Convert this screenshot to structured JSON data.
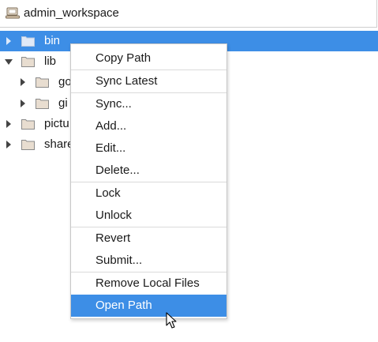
{
  "workspace": {
    "title": "admin_workspace",
    "icon": "workspace-icon"
  },
  "tree": {
    "items": [
      {
        "label": "bin",
        "icon": "folder-icon",
        "expander": "collapsed",
        "selected": true
      },
      {
        "label": "lib",
        "icon": "folder-icon",
        "expander": "expanded",
        "selected": false
      },
      {
        "label": "go",
        "icon": "folder-icon",
        "expander": "collapsed",
        "selected": false
      },
      {
        "label": "gi",
        "icon": "folder-icon",
        "expander": "collapsed",
        "selected": false
      },
      {
        "label": "pictu",
        "icon": "folder-icon",
        "expander": "collapsed",
        "selected": false
      },
      {
        "label": "share",
        "icon": "folder-icon",
        "expander": "collapsed",
        "selected": false
      }
    ]
  },
  "context_menu": {
    "items": [
      {
        "label": "Copy Path"
      },
      {
        "label": "Sync Latest"
      },
      {
        "label": "Sync..."
      },
      {
        "label": "Add..."
      },
      {
        "label": "Edit..."
      },
      {
        "label": "Delete..."
      },
      {
        "label": "Lock"
      },
      {
        "label": "Unlock"
      },
      {
        "label": "Revert"
      },
      {
        "label": "Submit..."
      },
      {
        "label": "Remove Local Files"
      },
      {
        "label": "Open Path",
        "highlighted": true
      }
    ]
  },
  "colors": {
    "selection": "#3d8ee6",
    "folder_fill": "#e8ddd0",
    "folder_stroke": "#8a8a8a"
  }
}
